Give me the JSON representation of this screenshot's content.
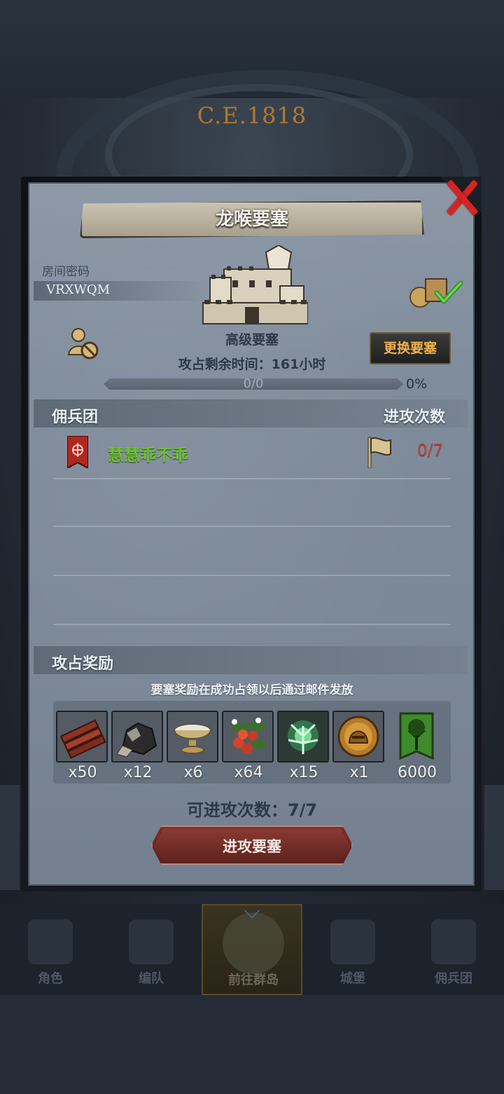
{
  "background": {
    "era": "C.E.1818"
  },
  "nav": {
    "items": [
      {
        "label": "角色"
      },
      {
        "label": "编队"
      },
      {
        "label": "前往群岛"
      },
      {
        "label": "城堡"
      },
      {
        "label": "佣兵团"
      }
    ]
  },
  "dialog": {
    "title": "龙喉要塞",
    "room_label": "房间密码",
    "room_code": "VRXWQM",
    "fortress_type": "高级要塞",
    "change_label": "更换要塞",
    "time_left": "攻占剩余时间：161小时",
    "progress": {
      "text": "0/0",
      "percent_text": "0%",
      "fraction": 0
    },
    "guild_header": "佣兵团",
    "attacks_header": "进攻次数",
    "members": [
      {
        "name": "慧慧乖不乖",
        "attacks": "0/7"
      }
    ],
    "reward_header": "攻占奖励",
    "reward_note": "要塞奖励在成功占领以后通过邮件发放",
    "rewards": [
      {
        "icon": "wood-planks-icon",
        "count": "x50"
      },
      {
        "icon": "ore-rock-icon",
        "count": "x12"
      },
      {
        "icon": "silver-bowl-icon",
        "count": "x6"
      },
      {
        "icon": "berries-icon",
        "count": "x64"
      },
      {
        "icon": "green-spirit-tree-icon",
        "count": "x15"
      },
      {
        "icon": "golden-helmet-medal-icon",
        "count": "x1"
      },
      {
        "icon": "green-tree-banner-icon",
        "count": "6000"
      }
    ],
    "attacks_left": "可进攻次数：7/7",
    "attack_button": "进攻要塞"
  },
  "colors": {
    "close": "#d42525",
    "gold_text": "#f0b348",
    "member_green": "#6ec13a",
    "attack_red": "#b8463e"
  }
}
